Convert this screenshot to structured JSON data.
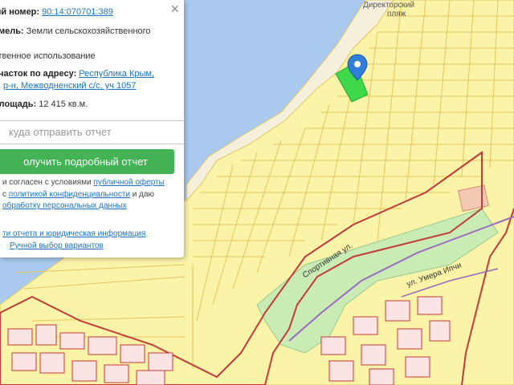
{
  "map": {
    "street_labels": [
      "Спортивная ул.",
      "ул. Умера Ипчи"
    ],
    "place_label_line1": "Директорский",
    "place_label_line2": "пляж",
    "colors": {
      "water": "#a9c9ee",
      "parcel_fill": "#fbf3a8",
      "parcel_border": "#e6c55c",
      "selected_parcel": "#3ed84a",
      "district_border": "#c23a3a",
      "green_area": "#c9ecb5",
      "marker": "#2f7ed8"
    },
    "marker_icon": "map-pin-icon"
  },
  "panel": {
    "cadastral_label": "ый номер:",
    "cadastral_value": "90:14:070701:389",
    "land_label": "емель:",
    "land_value": "Земли сельскохозяйственного",
    "usage_text": "ственное использование",
    "address_label": "участок по адресу:",
    "address_line1": "Республика Крым,",
    "address_line2": "р-н, Межводненский с/с, уч 1057",
    "area_label": "площадь:",
    "area_value": "12 415 кв.м.",
    "email_placeholder": "куда отправить отчет",
    "report_button": "олучить подробный отчет",
    "agree_prefix": "и согласен с условиями",
    "agree_offer_link": "публичной оферты",
    "agree_c": "с",
    "agree_privacy_link": "политикой конфиденциальности",
    "agree_and": "и даю",
    "agree_data_link": "обработку персональных данных",
    "report_info_link": "ти отчета и юридическая информация",
    "manual_select_link": "Ручной выбор вариантов",
    "close_icon": "close-icon"
  }
}
